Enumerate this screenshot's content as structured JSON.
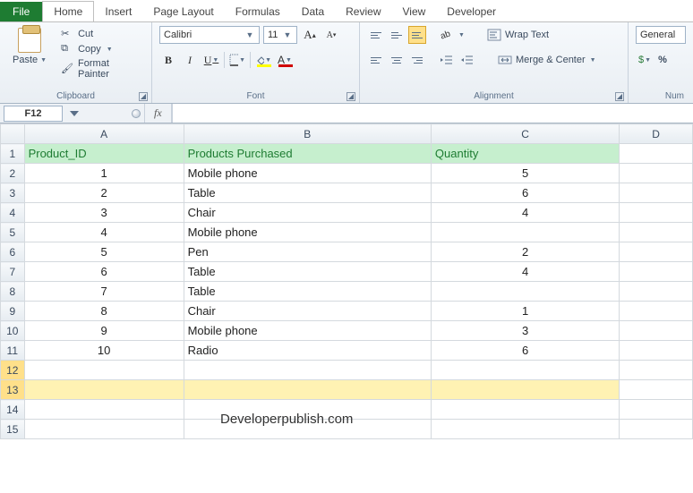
{
  "tabs": {
    "file": "File",
    "home": "Home",
    "insert": "Insert",
    "pagelayout": "Page Layout",
    "formulas": "Formulas",
    "data": "Data",
    "review": "Review",
    "view": "View",
    "developer": "Developer"
  },
  "clipboard": {
    "paste": "Paste",
    "cut": "Cut",
    "copy": "Copy",
    "formatpainter": "Format Painter",
    "group": "Clipboard"
  },
  "font": {
    "name": "Calibri",
    "size": "11",
    "group": "Font"
  },
  "alignment": {
    "wrap": "Wrap Text",
    "merge": "Merge & Center",
    "group": "Alignment"
  },
  "number": {
    "format": "General",
    "group": "Num"
  },
  "namebox": "F12",
  "fx": "fx",
  "formula": "",
  "columns": [
    "A",
    "B",
    "C",
    "D"
  ],
  "headers": {
    "A": "Product_ID",
    "B": "Products Purchased",
    "C": "Quantity"
  },
  "rows": [
    {
      "n": "2",
      "A": "1",
      "B": "Mobile phone",
      "C": "5"
    },
    {
      "n": "3",
      "A": "2",
      "B": "Table",
      "C": "6"
    },
    {
      "n": "4",
      "A": "3",
      "B": "Chair",
      "C": "4"
    },
    {
      "n": "5",
      "A": "4",
      "B": "Mobile phone",
      "C": ""
    },
    {
      "n": "6",
      "A": "5",
      "B": "Pen",
      "C": "2"
    },
    {
      "n": "7",
      "A": "6",
      "B": "Table",
      "C": "4"
    },
    {
      "n": "8",
      "A": "7",
      "B": "Table",
      "C": ""
    },
    {
      "n": "9",
      "A": "8",
      "B": "Chair",
      "C": "1"
    },
    {
      "n": "10",
      "A": "9",
      "B": "Mobile phone",
      "C": "3"
    },
    {
      "n": "11",
      "A": "10",
      "B": "Radio",
      "C": "6"
    }
  ],
  "emptyRows": [
    "14",
    "15"
  ],
  "watermark": "Developerpublish.com"
}
